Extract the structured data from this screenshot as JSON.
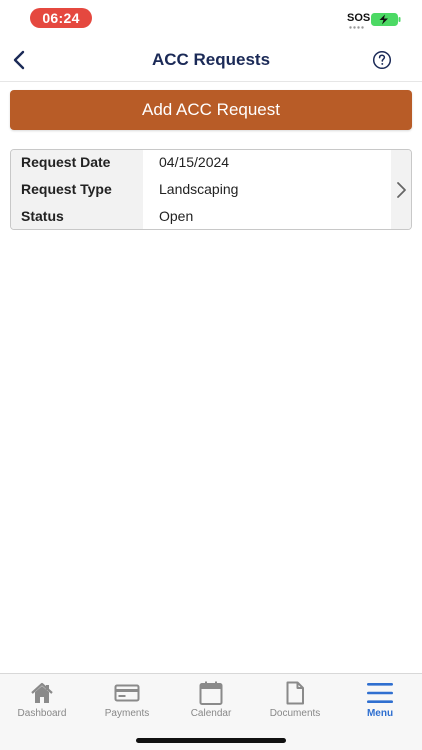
{
  "status_bar": {
    "time": "06:24",
    "carrier": "SOS",
    "battery_icon": "battery-charging-icon",
    "colors": {
      "time_pill": "#e5483f",
      "battery": "#4cd964"
    }
  },
  "nav": {
    "title": "ACC Requests",
    "back_icon": "chevron-left-icon",
    "help_icon": "question-circle-icon",
    "colors": {
      "title": "#1b2a57"
    }
  },
  "add_button": {
    "label": "Add ACC Request",
    "color": "#b85c27"
  },
  "requests": [
    {
      "rows": [
        {
          "label": "Request Date",
          "value": "04/15/2024"
        },
        {
          "label": "Request Type",
          "value": "Landscaping"
        },
        {
          "label": "Status",
          "value": "Open"
        }
      ]
    }
  ],
  "tab_bar": {
    "active_color": "#2f6fd0",
    "tabs": [
      {
        "label": "Dashboard",
        "icon": "home-icon",
        "active": false
      },
      {
        "label": "Payments",
        "icon": "credit-card-icon",
        "active": false
      },
      {
        "label": "Calendar",
        "icon": "calendar-icon",
        "active": false
      },
      {
        "label": "Documents",
        "icon": "document-icon",
        "active": false
      },
      {
        "label": "Menu",
        "icon": "menu-icon",
        "active": true
      }
    ]
  }
}
